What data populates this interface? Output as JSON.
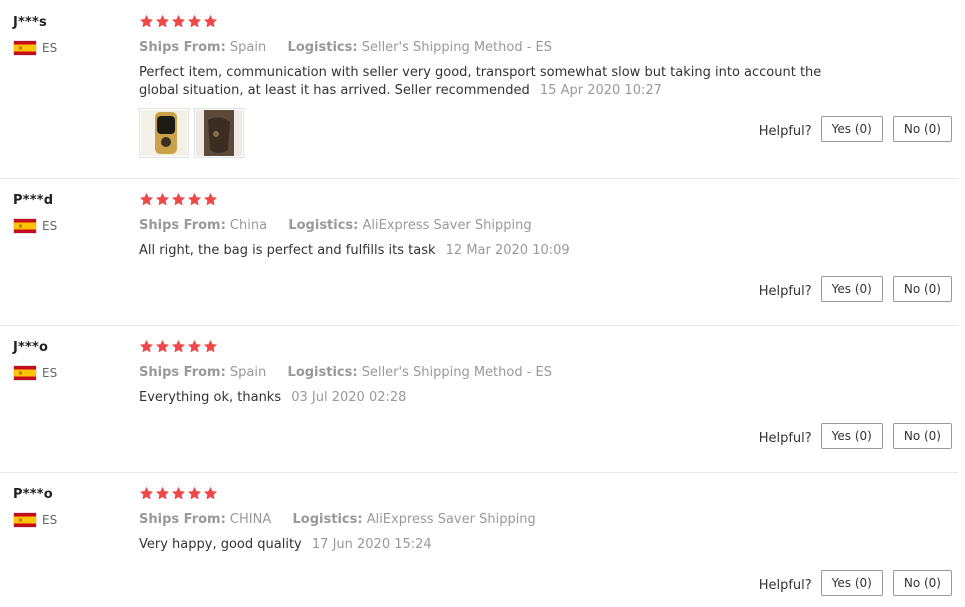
{
  "reviews": [
    {
      "user": "J***s",
      "country_code": "ES",
      "rating": 5,
      "ships_label": "Ships From:",
      "ships_value": "Spain",
      "logistics_label": "Logistics:",
      "logistics_value": "Seller's Shipping Method - ES",
      "text": "Perfect item, communication with seller very good, transport somewhat slow but taking into account the global situation, at least it has arrived. Seller recommended",
      "date": "15 Apr 2020 10:27",
      "has_photos": true,
      "helpful_label": "Helpful?",
      "yes_label": "Yes (0)",
      "no_label": "No (0)"
    },
    {
      "user": "P***d",
      "country_code": "ES",
      "rating": 5,
      "ships_label": "Ships From:",
      "ships_value": "China",
      "logistics_label": "Logistics:",
      "logistics_value": "AliExpress Saver Shipping",
      "text": "All right, the bag is perfect and fulfills its task",
      "date": "12 Mar 2020 10:09",
      "has_photos": false,
      "helpful_label": "Helpful?",
      "yes_label": "Yes (0)",
      "no_label": "No (0)"
    },
    {
      "user": "J***o",
      "country_code": "ES",
      "rating": 5,
      "ships_label": "Ships From:",
      "ships_value": "Spain",
      "logistics_label": "Logistics:",
      "logistics_value": "Seller's Shipping Method - ES",
      "text": "Everything ok, thanks",
      "date": "03 Jul 2020 02:28",
      "has_photos": false,
      "helpful_label": "Helpful?",
      "yes_label": "Yes (0)",
      "no_label": "No (0)"
    },
    {
      "user": "P***o",
      "country_code": "ES",
      "rating": 5,
      "ships_label": "Ships From:",
      "ships_value": "CHINA",
      "logistics_label": "Logistics:",
      "logistics_value": "AliExpress Saver Shipping",
      "text": "Very happy, good quality",
      "date": "17 Jun 2020 15:24",
      "has_photos": false,
      "helpful_label": "Helpful?",
      "yes_label": "Yes (0)",
      "no_label": "No (0)"
    }
  ],
  "colors": {
    "star": "#f04848",
    "muted": "#999999",
    "flag_red": "#c60b1e",
    "flag_yellow": "#ffc400"
  },
  "icons": {
    "star": "star-icon",
    "flag": "spain-flag-icon"
  }
}
